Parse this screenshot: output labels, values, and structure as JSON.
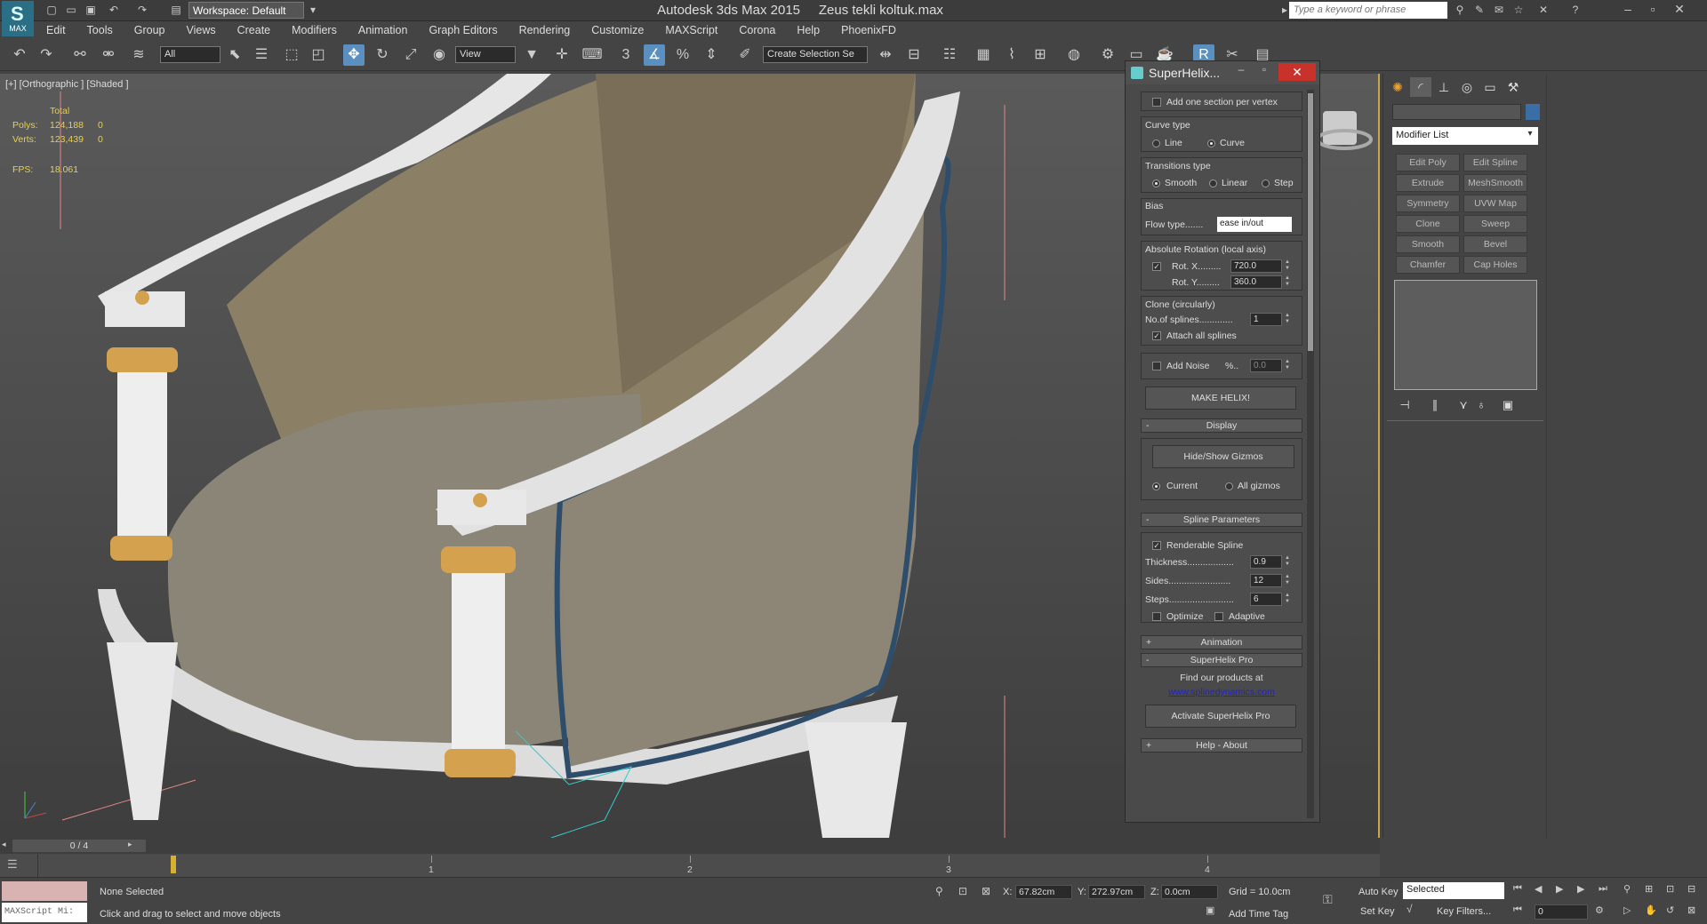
{
  "app": {
    "title": "Autodesk 3ds Max  2015",
    "file": "Zeus tekli koltuk.max",
    "logo": "MAX",
    "workspace": "Workspace: Default",
    "search_placeholder": "Type a keyword or phrase"
  },
  "menu": [
    "Edit",
    "Tools",
    "Group",
    "Views",
    "Create",
    "Modifiers",
    "Animation",
    "Graph Editors",
    "Rendering",
    "Customize",
    "MAXScript",
    "Corona",
    "Help",
    "PhoenixFD"
  ],
  "toolbar": {
    "filter": "All",
    "ref_coord": "View",
    "selection_set": "Create Selection Se",
    "snap_count": "3"
  },
  "viewport": {
    "label": "[+] [Orthographic ] [Shaded ]",
    "stats": {
      "header": "Total",
      "polys_label": "Polys:",
      "polys": "124,188",
      "polys_sel": "0",
      "verts_label": "Verts:",
      "verts": "123,439",
      "verts_sel": "0",
      "fps_label": "FPS:",
      "fps": "18.061"
    }
  },
  "dialog": {
    "title": "SuperHelix...",
    "add_section": "Add one section per vertex",
    "curve_type": {
      "title": "Curve type",
      "line": "Line",
      "curve": "Curve"
    },
    "transitions": {
      "title": "Transitions type",
      "smooth": "Smooth",
      "linear": "Linear",
      "step": "Step"
    },
    "bias": {
      "title": "Bias",
      "flow_label": "Flow type.......",
      "flow_value": "ease in/out"
    },
    "rotation": {
      "title": "Absolute Rotation (local axis)",
      "rot_x_label": "Rot. X.........",
      "rot_x": "720.0",
      "rot_y_label": "Rot. Y.........",
      "rot_y": "360.0"
    },
    "clone": {
      "title": "Clone (circularly)",
      "splines_label": "No.of splines.............",
      "splines": "1",
      "attach": "Attach all splines"
    },
    "noise": {
      "label": "Add Noise",
      "pct": "%..",
      "value": "0.0"
    },
    "make_helix": "MAKE HELIX!",
    "display": {
      "rollout": "Display",
      "hide_show": "Hide/Show Gizmos",
      "current": "Current",
      "all": "All gizmos"
    },
    "spline": {
      "rollout": "Spline Parameters",
      "renderable": "Renderable Spline",
      "thickness_label": "Thickness..................",
      "thickness": "0.9",
      "sides_label": "Sides........................",
      "sides": "12",
      "steps_label": "Steps.........................",
      "steps": "6",
      "optimize": "Optimize",
      "adaptive": "Adaptive"
    },
    "animation_rollout": "Animation",
    "pro": {
      "rollout": "SuperHelix Pro",
      "find": "Find our products at",
      "url": "www.splinedynamics.com",
      "activate": "Activate SuperHelix Pro"
    },
    "help_rollout": "Help - About",
    "sign_minus": "-",
    "sign_plus": "+"
  },
  "command_panel": {
    "modifier_list": "Modifier List",
    "buttons": [
      "Edit Poly",
      "Edit Spline",
      "Extrude",
      "MeshSmooth",
      "Symmetry",
      "UVW Map",
      "Clone",
      "Sweep",
      "Smooth",
      "Bevel",
      "Chamfer",
      "Cap Holes"
    ]
  },
  "timeline": {
    "frame": "0 / 4",
    "ticks": [
      "1",
      "2",
      "3",
      "4"
    ]
  },
  "status": {
    "maxscript": "MAXScript Mi:",
    "selection": "None Selected",
    "prompt": "Click and drag to select and move objects",
    "x_label": "X:",
    "x": "67.82cm",
    "y_label": "Y:",
    "y": "272.97cm",
    "z_label": "Z:",
    "z": "0.0cm",
    "grid": "Grid = 10.0cm",
    "add_time_tag": "Add Time Tag",
    "auto_key": "Auto Key",
    "set_key": "Set Key",
    "key_mode": "Selected",
    "key_filters": "Key Filters...",
    "frame": "0"
  },
  "colors": {
    "accent": "#5a8fbf",
    "close": "#c8322a",
    "viewport_border": "#c9a64a",
    "link": "#2222cc"
  }
}
